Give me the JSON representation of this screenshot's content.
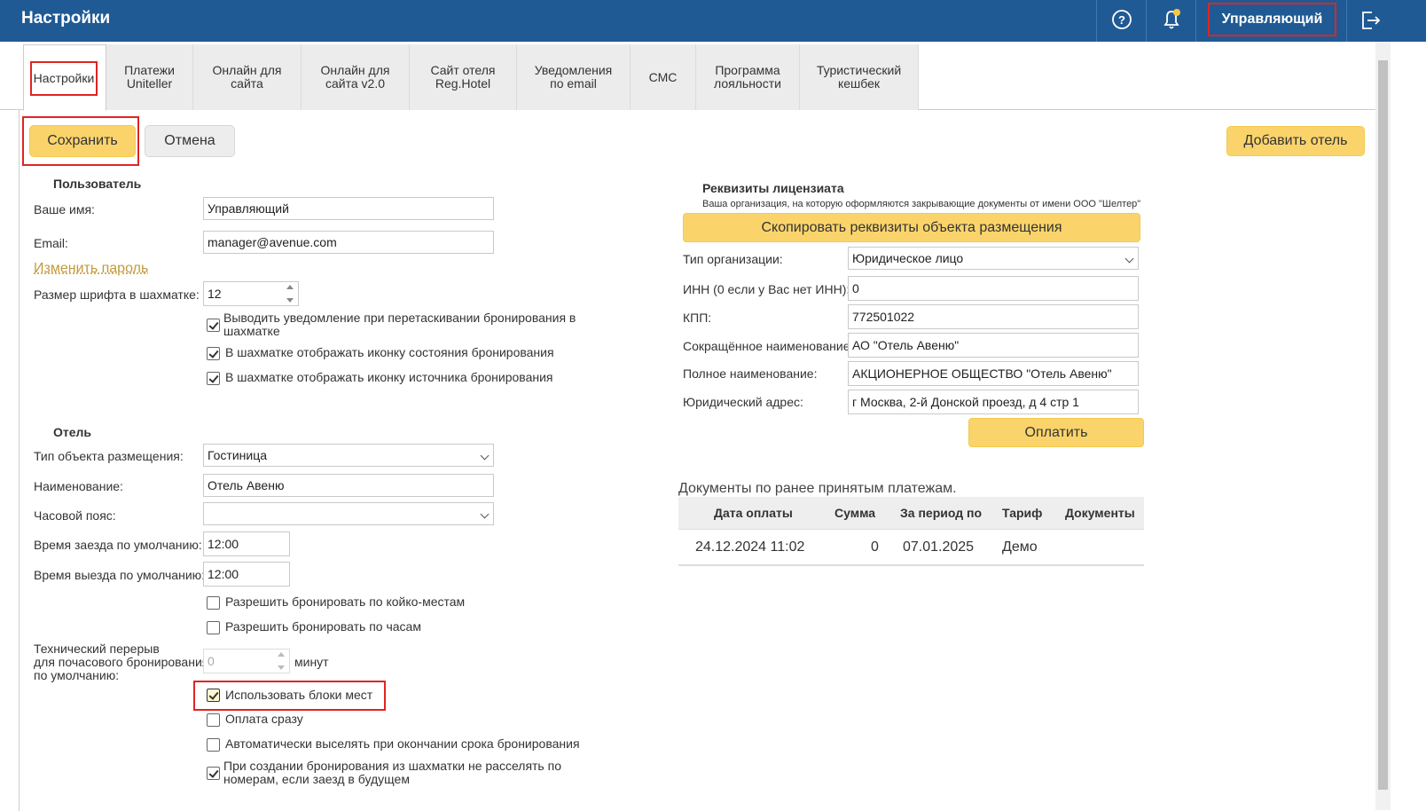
{
  "header": {
    "title": "Настройки",
    "user_button": "Управляющий"
  },
  "tabs": [
    {
      "label": "Настройки"
    },
    {
      "label": "Платежи Uniteller"
    },
    {
      "label": "Онлайн для сайта"
    },
    {
      "label": "Онлайн для сайта v2.0"
    },
    {
      "label": "Сайт отеля Reg.Hotel"
    },
    {
      "label": "Уведомления по email"
    },
    {
      "label": "СМС"
    },
    {
      "label": "Программа лояльности"
    },
    {
      "label": "Туристический кешбек"
    }
  ],
  "toolbar": {
    "save": "Сохранить",
    "cancel": "Отмена",
    "add_hotel": "Добавить отель"
  },
  "user": {
    "section_title": "Пользователь",
    "name_label": "Ваше имя:",
    "name_value": "Управляющий",
    "email_label": "Email:",
    "email_value": "manager@avenue.com",
    "change_password": "Изменить пароль",
    "font_size_label": "Размер шрифта в шахматке:",
    "font_size_value": "12",
    "checkboxes": [
      {
        "label": "Выводить уведомление при перетаскивании бронирования в шахматке",
        "checked": true
      },
      {
        "label": "В шахматке отображать иконку состояния бронирования",
        "checked": true
      },
      {
        "label": "В шахматке отображать иконку источника бронирования",
        "checked": true
      }
    ]
  },
  "hotel": {
    "section_title": "Отель",
    "type_label": "Тип объекта размещения:",
    "type_value": "Гостиница",
    "name_label": "Наименование:",
    "name_value": "Отель Авеню",
    "timezone_label": "Часовой пояс:",
    "timezone_value": "",
    "checkin_label": "Время заезда по умолчанию:",
    "checkin_value": "12:00",
    "checkout_label": "Время выезда по умолчанию:",
    "checkout_value": "12:00",
    "allow_checkboxes": [
      {
        "label": "Разрешить бронировать по койко-местам",
        "checked": false
      },
      {
        "label": "Разрешить бронировать по часам",
        "checked": false
      }
    ],
    "break_label_1": "Технический перерыв",
    "break_label_2": "для почасового бронирования",
    "break_label_3": "по умолчанию:",
    "break_value": "0",
    "break_unit": "минут",
    "bottom_checkboxes": [
      {
        "label": "Использовать блоки мест",
        "checked": true
      },
      {
        "label": "Оплата сразу",
        "checked": false
      },
      {
        "label": "Автоматически выселять при окончании срока бронирования",
        "checked": false
      },
      {
        "label": "При создании бронирования из шахматки не расселять по номерам, если заезд в будущем",
        "checked": true
      }
    ]
  },
  "licensee": {
    "section_title": "Реквизиты лицензиата",
    "note": "Ваша организация, на которую оформляются закрывающие документы от имени ООО \"Шелтер\"",
    "copy_button": "Скопировать реквизиты объекта размещения",
    "org_type_label": "Тип организации:",
    "org_type_value": "Юридическое лицо",
    "inn_label": "ИНН (0 если у Вас нет ИНН):",
    "inn_value": "0",
    "kpp_label": "КПП:",
    "kpp_value": "772501022",
    "short_name_label": "Сокращённое наименование:",
    "short_name_value": "АО \"Отель Авеню\"",
    "full_name_label": "Полное наименование:",
    "full_name_value": "АКЦИОНЕРНОЕ ОБЩЕСТВО \"Отель Авеню\"",
    "address_label": "Юридический адрес:",
    "address_value": "г Москва, 2-й Донской проезд, д 4 стр 1",
    "pay_button": "Оплатить"
  },
  "documents": {
    "title": "Документы по ранее принятым платежам.",
    "columns": [
      "Дата оплаты",
      "Сумма",
      "За период по",
      "Тариф",
      "Документы"
    ],
    "rows": [
      [
        "24.12.2024 11:02",
        "0",
        "07.01.2025",
        "Демо",
        ""
      ]
    ]
  },
  "colors": {
    "header_bg": "#1f5a94",
    "accent_yellow": "#fad46b",
    "highlight_red": "#e02424",
    "link": "#c39a3a"
  },
  "icons": [
    "help-icon",
    "bell-icon",
    "logout-icon",
    "chevron-down-icon",
    "check-icon"
  ]
}
